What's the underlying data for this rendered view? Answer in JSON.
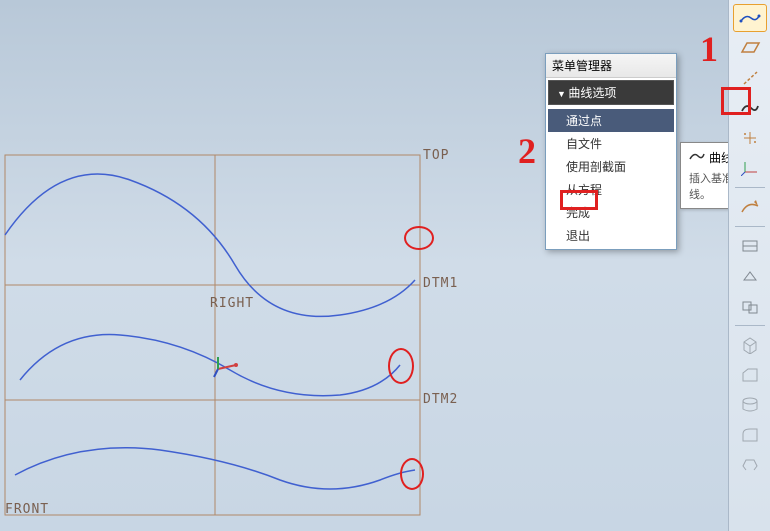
{
  "datum_labels": {
    "top": "TOP",
    "right": "RIGHT",
    "dtm1": "DTM1",
    "dtm2": "DTM2",
    "front": "FRONT"
  },
  "menu": {
    "title": "菜单管理器",
    "header": "曲线选项",
    "items": {
      "through_points": "通过点",
      "from_file": "自文件",
      "use_section": "使用剖截面",
      "from_equation": "从方程",
      "done": "完成",
      "quit": "退出"
    }
  },
  "tooltip": {
    "title": "曲线",
    "description": "插入基准曲线。"
  },
  "annotations": {
    "num1": "1",
    "num2": "2"
  },
  "tools": {
    "curve_sketch": "curve-sketch",
    "plane": "plane",
    "axis": "axis",
    "curve": "curve",
    "point": "point",
    "csys": "csys",
    "sketch": "sketch",
    "analysis1": "analysis1",
    "analysis2": "analysis2",
    "analysis3": "analysis3",
    "extrude": "extrude",
    "chamfer": "chamfer",
    "hole": "hole",
    "round": "round",
    "shell": "shell"
  }
}
